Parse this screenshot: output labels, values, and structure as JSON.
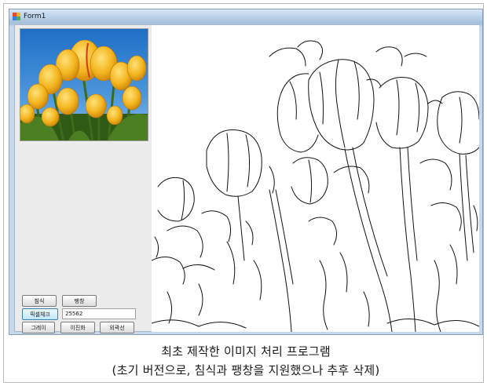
{
  "window": {
    "title": "Form1"
  },
  "buttons": {
    "erosion": "침식",
    "dilation": "팽창",
    "pixel_check": "픽셀체크",
    "gray": "그레이",
    "binarize": "이진화",
    "outline": "외곽선"
  },
  "pixel_check_value": "25562",
  "caption": {
    "line1": "최초 제작한 이미지 처리 프로그램",
    "line2": "(초기 버전으로, 침식과 팽창을 지원했으나 추후 삭제)"
  },
  "colors": {
    "sky": "#2f7fd0",
    "tulip": "#f2b21e",
    "stem": "#3d6b1c",
    "edge_line": "#111111"
  }
}
